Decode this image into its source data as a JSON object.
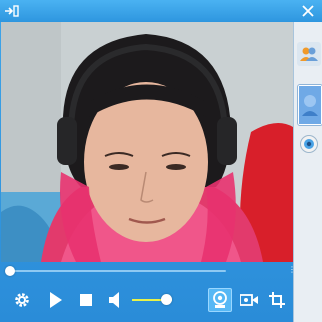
{
  "window": {
    "accent": "#2a8cd8",
    "titlebar_left_icon": "pin-to-side-icon",
    "titlebar_right_icon": "close-icon"
  },
  "video": {
    "content": "webcam-feed",
    "playback_progress": 0.0
  },
  "right_panel": {
    "items": [
      {
        "icon": "contacts-icon"
      },
      {
        "icon": "avatar-thumbnail"
      },
      {
        "icon": "camera-eye-icon"
      }
    ]
  },
  "controls": {
    "buttons": [
      {
        "icon": "settings-gear-icon"
      },
      {
        "icon": "play-icon"
      },
      {
        "icon": "stop-icon"
      },
      {
        "icon": "volume-icon"
      },
      {
        "icon": "webcam-icon",
        "active": true
      },
      {
        "icon": "video-record-icon"
      },
      {
        "icon": "crop-icon"
      }
    ],
    "volume_level": 0.85
  }
}
